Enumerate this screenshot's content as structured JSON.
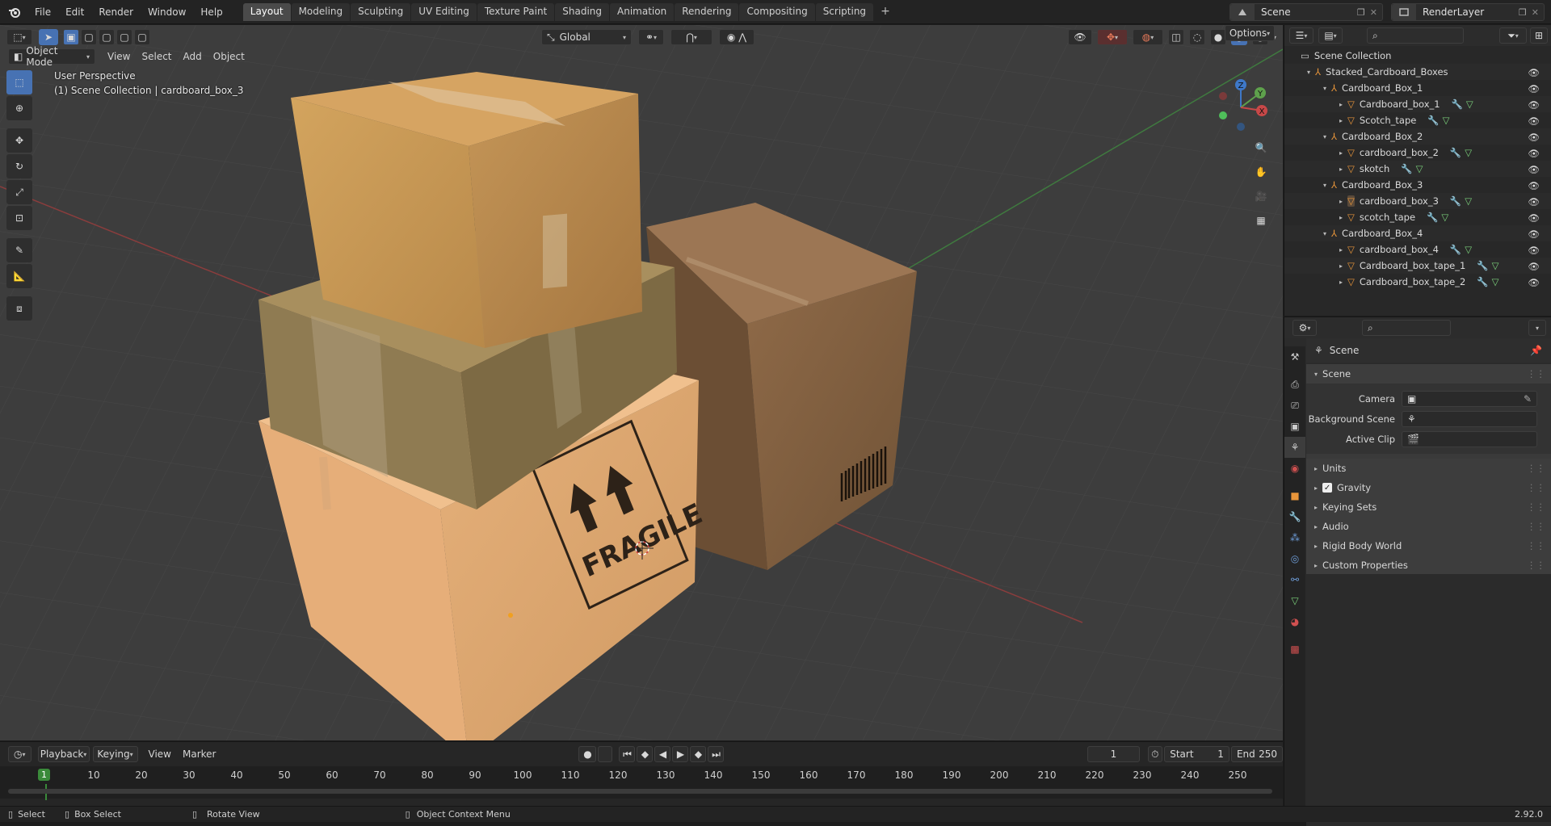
{
  "topbar": {
    "menus": [
      "File",
      "Edit",
      "Render",
      "Window",
      "Help"
    ],
    "workspaces": [
      "Layout",
      "Modeling",
      "Sculpting",
      "UV Editing",
      "Texture Paint",
      "Shading",
      "Animation",
      "Rendering",
      "Compositing",
      "Scripting"
    ],
    "active_workspace": "Layout",
    "scene_name": "Scene",
    "view_layer": "RenderLayer"
  },
  "viewport": {
    "mode": "Object Mode",
    "menus": [
      "View",
      "Select",
      "Add",
      "Object"
    ],
    "transform_orientation": "Global",
    "options_label": "Options",
    "perspective_label": "User Perspective",
    "collection_label": "(1) Scene Collection | cardboard_box_3",
    "fragile_text": "FRAGILE",
    "axes": {
      "x": "X",
      "y": "Y",
      "z": "Z"
    }
  },
  "timeline": {
    "playback": "Playback",
    "keying": "Keying",
    "view": "View",
    "marker": "Marker",
    "current_frame": "1",
    "start_label": "Start",
    "start": "1",
    "end_label": "End",
    "end": "250",
    "ticks": [
      "10",
      "20",
      "30",
      "40",
      "50",
      "60",
      "70",
      "80",
      "90",
      "100",
      "110",
      "120",
      "130",
      "140",
      "150",
      "160",
      "170",
      "180",
      "190",
      "200",
      "210",
      "220",
      "230",
      "240",
      "250"
    ],
    "playhead": "1"
  },
  "outliner": {
    "root": "Scene Collection",
    "rows": [
      {
        "label": "Stacked_Cardboard_Boxes",
        "kind": "empty"
      },
      {
        "label": "Cardboard_Box_1",
        "kind": "empty"
      },
      {
        "label": "Cardboard_box_1",
        "kind": "mesh"
      },
      {
        "label": "Scotch_tape",
        "kind": "mesh"
      },
      {
        "label": "Cardboard_Box_2",
        "kind": "empty"
      },
      {
        "label": "cardboard_box_2",
        "kind": "mesh"
      },
      {
        "label": "skotch",
        "kind": "mesh"
      },
      {
        "label": "Cardboard_Box_3",
        "kind": "empty"
      },
      {
        "label": "cardboard_box_3",
        "kind": "mesh"
      },
      {
        "label": "scotch_tape",
        "kind": "mesh"
      },
      {
        "label": "Cardboard_Box_4",
        "kind": "empty"
      },
      {
        "label": "cardboard_box_4",
        "kind": "mesh"
      },
      {
        "label": "Cardboard_box_tape_1",
        "kind": "mesh"
      },
      {
        "label": "Cardboard_box_tape_2",
        "kind": "mesh"
      }
    ]
  },
  "properties": {
    "breadcrumb": "Scene",
    "panel_title": "Scene",
    "camera_label": "Camera",
    "background_scene_label": "Background Scene",
    "active_clip_label": "Active Clip",
    "sections": [
      "Units",
      "Gravity",
      "Keying Sets",
      "Audio",
      "Rigid Body World",
      "Custom Properties"
    ],
    "gravity_checked": true
  },
  "status": {
    "select": "Select",
    "box_select": "Box Select",
    "rotate_view": "Rotate View",
    "context_menu": "Object Context Menu",
    "version": "2.92.0"
  },
  "colors": {
    "accent": "#4772b3",
    "x_axis": "#c84848",
    "y_axis": "#5ea14c",
    "z_axis": "#3e78c8",
    "playhead": "#3a8a3a"
  }
}
